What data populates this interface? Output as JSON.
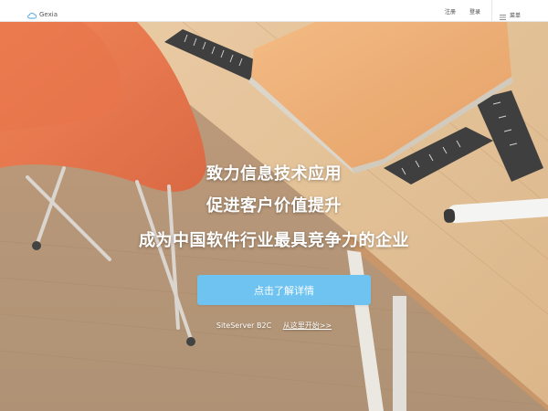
{
  "navbar": {
    "brand": "Gexia",
    "logo_icon": "cloud-icon",
    "register_label": "注册",
    "login_label": "登录",
    "menu_label": "菜单",
    "menu_icon": "hamburger-icon"
  },
  "hero": {
    "headline_lines": [
      "致力信息技术应用",
      "促进客户价值提升",
      "成为中国软件行业最具竞争力的企业"
    ],
    "cta_label": "点击了解详情",
    "product_label": "SiteServer B2C",
    "start_link_label": "从这里开始>>",
    "colors": {
      "cta_bg": "#6ec3f1",
      "text": "#ffffff"
    }
  }
}
